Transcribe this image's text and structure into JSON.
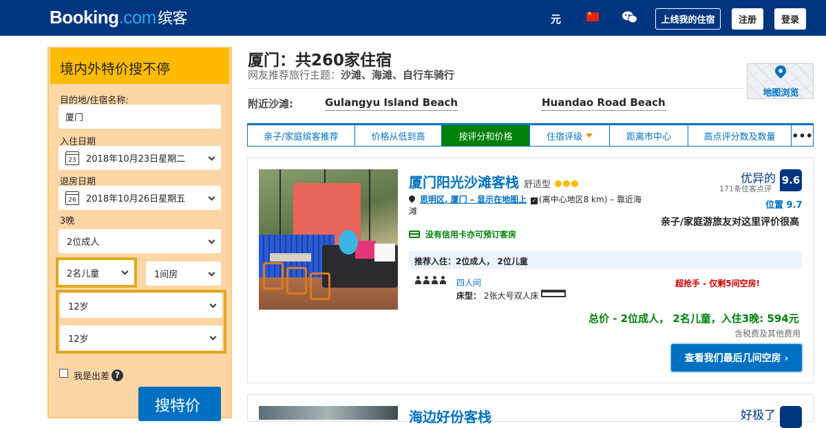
{
  "header": {
    "logo_main": "Booking",
    "logo_dot": ".com",
    "logo_cn": "缤客",
    "currency": "元",
    "list_property": "上线我的住宿",
    "register": "注册",
    "login": "登录"
  },
  "sidebar": {
    "title": "境内外特价搜不停",
    "destination_label": "目的地/住宿名称:",
    "destination_value": "厦门",
    "checkin_label": "入住日期",
    "checkin_day": "23",
    "checkin_value": "2018年10月23日星期二",
    "checkout_label": "退房日期",
    "checkout_day": "26",
    "checkout_value": "2018年10月26日星期五",
    "nights": "3晚",
    "adults": "2位成人",
    "children": "2名儿童",
    "rooms": "1间房",
    "child_age_1": "12岁",
    "child_age_2": "12岁",
    "business_trip": "我是出差",
    "help": "?",
    "search_button": "搜特价"
  },
  "main": {
    "title": "厦门：共260家住宿",
    "subtitle_prefix": "网友推荐旅行主题：",
    "subtitle_themes": "沙滩、海滩、自行车骑行",
    "nearby_beach_label": "附近沙滩:",
    "beaches": [
      "Gulangyu Island Beach",
      "Huandao Road Beach"
    ],
    "map_label": "地图浏览",
    "tabs": [
      "亲子/家庭缤客推荐",
      "价格从低到高",
      "按评分和价格",
      "住宿评级",
      "距离市中心",
      "高点评分数及数量",
      "•••"
    ]
  },
  "listing": {
    "name": "厦门阳光沙滩客栈",
    "type": "舒适型",
    "location_link": "思明区, 厦门 – 显示在地图上",
    "location_rest": "(离中心地区8 km) – 靠近海滩",
    "no_card": "没有信用卡亦可预订客房",
    "recommended": "推荐入住：2位成人， 2位儿童",
    "room_name": "四人间",
    "bed_label": "床型：",
    "bed_value": "2张大号双人床",
    "urgent": "超抢手 - 仅剩5间空房!",
    "total": "总价 - 2位成人， 2名儿童，入住3晚: 594元",
    "tax": "含税费及其他费用",
    "cta": "查看我们最后几间空房 ›",
    "review_word": "优异的",
    "review_count": "171条住客点评",
    "score": "9.6",
    "location_score": "位置 9.7",
    "family_note": "亲子/家庭游旅友对这里评价很高",
    "stars": 3
  },
  "listing2": {
    "name": "海边好份客栈",
    "review_word": "好极了"
  }
}
